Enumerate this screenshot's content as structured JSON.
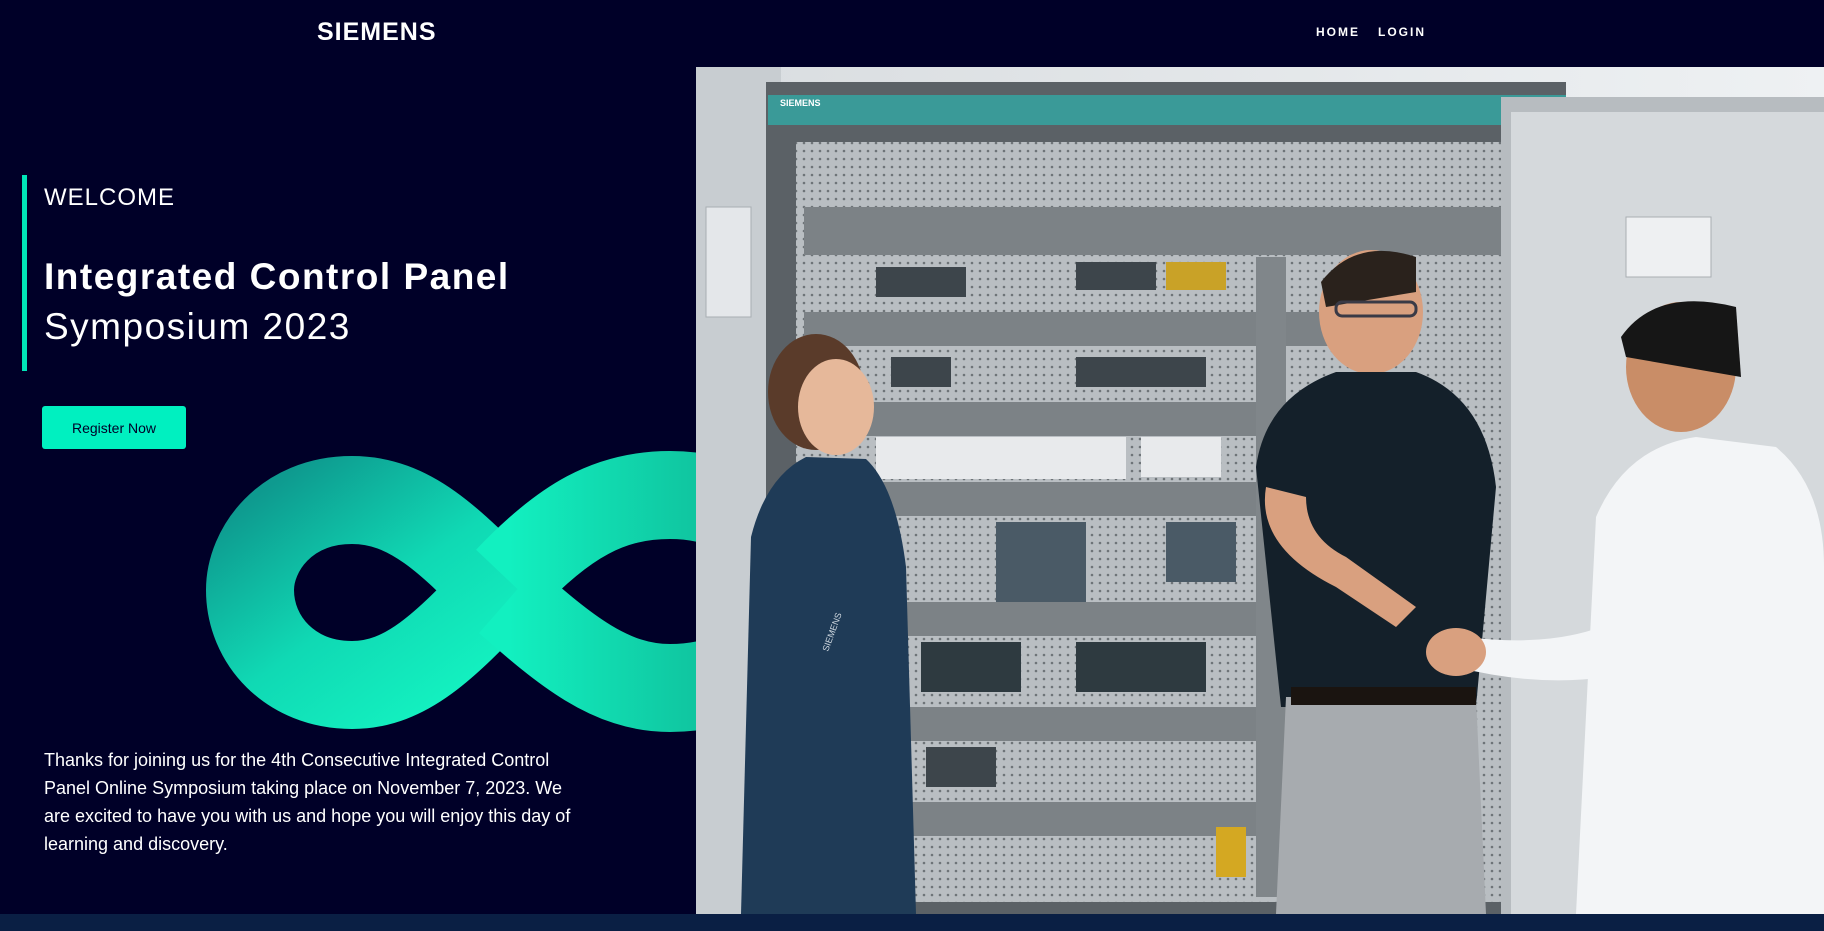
{
  "header": {
    "logo": "SIEMENS",
    "nav": [
      {
        "label": "HOME"
      },
      {
        "label": "LOGIN"
      }
    ]
  },
  "hero": {
    "welcome": "WELCOME",
    "title_bold": "Integrated Control Panel",
    "title_light": "Symposium 2023",
    "register_label": "Register Now",
    "intro": "Thanks for joining us for the 4th Consecutive Integrated Control Panel Online Symposium taking place on November 7, 2023. We are excited to have you with us and hope you will enjoy this day of learning and discovery."
  },
  "photo": {
    "cabinet_label": "SIEMENS",
    "shirt_label": "SIEMENS"
  },
  "colors": {
    "background": "#000028",
    "accent": "#00f0c0",
    "accent_dark": "#00a89a"
  }
}
